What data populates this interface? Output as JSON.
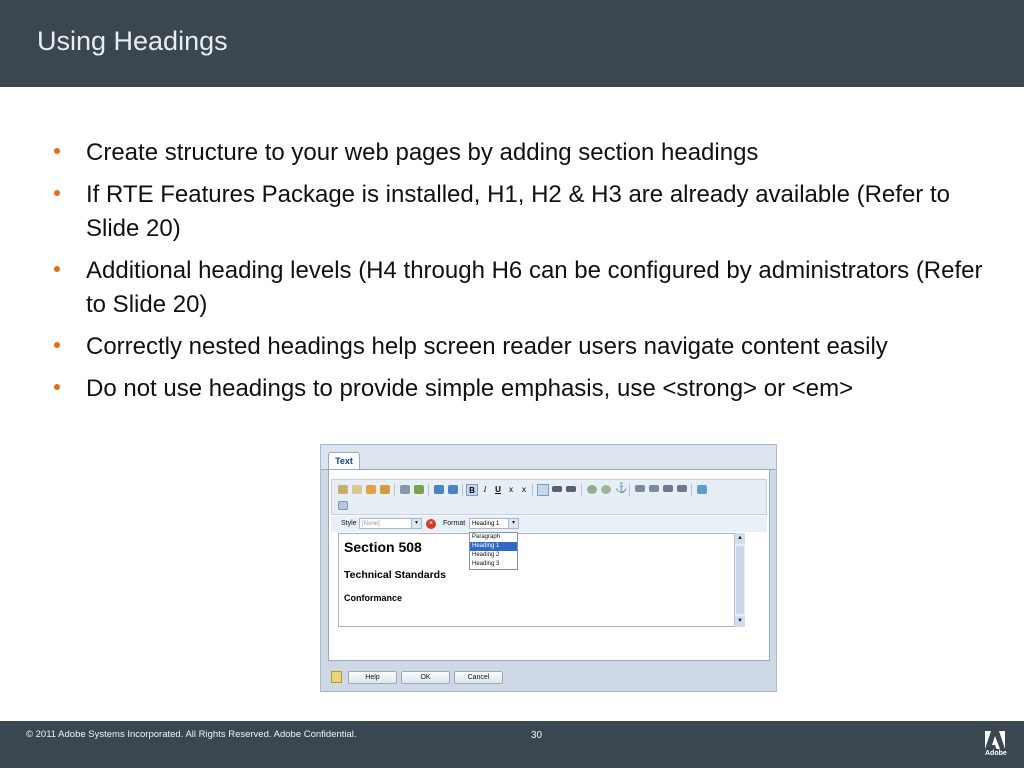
{
  "header": {
    "title": "Using Headings"
  },
  "bullets": [
    "Create structure to your web pages by adding section headings",
    "If RTE Features Package is installed, H1, H2 & H3 are already available (Refer to Slide 20)",
    "Additional heading levels (H4 through H6 can be configured by administrators (Refer to Slide 20)",
    "Correctly nested headings help screen reader users navigate content easily",
    "Do not use headings to provide simple emphasis, use <strong> or <em>"
  ],
  "dialog": {
    "tab_label": "Text",
    "toolbar": {
      "icons": [
        "paste-icon",
        "paste-text-icon",
        "paste-word-icon",
        "copy-icon",
        "find-icon",
        "replace-icon",
        "undo-icon",
        "redo-icon",
        "bold-icon",
        "italic-icon",
        "underline-icon",
        "subscript-icon",
        "superscript-icon",
        "align-left-icon",
        "align-center-icon",
        "align-right-icon",
        "link-icon",
        "unlink-icon",
        "anchor-icon",
        "bulleted-list-icon",
        "numbered-list-icon",
        "outdent-icon",
        "indent-icon",
        "spellcheck-icon",
        "table-icon"
      ],
      "bold_glyph": "B",
      "italic_glyph": "I",
      "underline_glyph": "U",
      "subscript_glyph": "x",
      "superscript_glyph": "x"
    },
    "style_label": "Style",
    "style_value": "[None]",
    "format_label": "Format",
    "format_value": "Heading 1",
    "format_options": [
      "Paragraph",
      "Heading 1",
      "Heading 2",
      "Heading 3"
    ],
    "format_selected": "Heading 1",
    "content": {
      "h1": "Section 508",
      "h2": "Technical Standards",
      "h3": "Conformance"
    },
    "buttons": {
      "help": "Help",
      "ok": "OK",
      "cancel": "Cancel"
    }
  },
  "footer": {
    "copyright": "© 2011 Adobe Systems Incorporated.  All Rights Reserved.  Adobe Confidential.",
    "page_number": "30",
    "logo_text": "Adobe"
  },
  "colors": {
    "bar": "#3a4650",
    "bullet": "#e06d1a",
    "dropdown_selected": "#316ac5"
  }
}
